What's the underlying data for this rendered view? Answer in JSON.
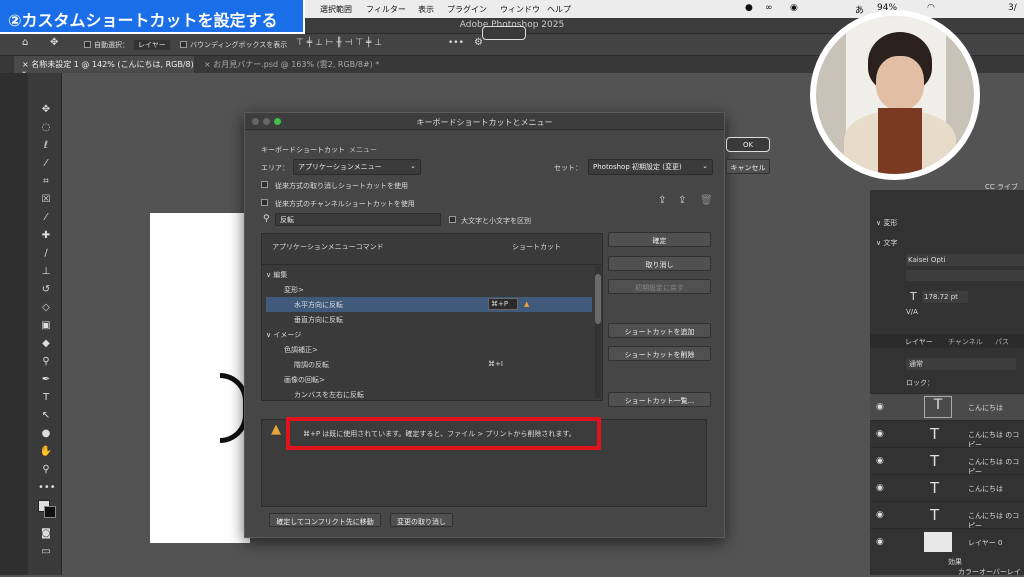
{
  "banner": "②カスタムショートカットを設定する",
  "menubar": {
    "items": [
      "選択範囲",
      "フィルター",
      "表示",
      "プラグイン",
      "ウィンドウ",
      "ヘルプ"
    ],
    "battery": "94%",
    "clock": "3/"
  },
  "app_title": "Adobe Photoshop 2025",
  "optbar": {
    "auto_select": "自動選択：",
    "auto_select_value": "レイヤー",
    "bbox": "バウンディングボックスを表示"
  },
  "tabs": [
    "名称未設定 1 @ 142% (こんにちは, RGB/8) *",
    "お月見バナー.psd @ 163% (雲2, RGB/8#) *"
  ],
  "dialog": {
    "title": "キーボードショートカットとメニュー",
    "tabs": [
      "キーボードショートカット",
      "メニュー"
    ],
    "area_label": "エリア：",
    "area_value": "アプリケーションメニュー",
    "set_label": "セット：",
    "set_value": "Photoshop 初期設定 (変更)",
    "cb1": "従来方式の取り消しショートカットを使用",
    "cb2": "従来方式のチャンネルショートカットを使用",
    "search_value": "反転",
    "case_label": "大文字と小文字を区別",
    "col_cmd": "アプリケーションメニューコマンド",
    "col_shortcut": "ショートカット",
    "rows": [
      {
        "label": "∨ 編集",
        "shortcut": ""
      },
      {
        "label": "変形>",
        "shortcut": ""
      },
      {
        "label": "水平方向に反転",
        "shortcut": "⌘+P"
      },
      {
        "label": "垂直方向に反転",
        "shortcut": ""
      },
      {
        "label": "∨ イメージ",
        "shortcut": ""
      },
      {
        "label": "色調補正>",
        "shortcut": ""
      },
      {
        "label": "階調の反転",
        "shortcut": "⌘+I"
      },
      {
        "label": "画像の回転>",
        "shortcut": ""
      },
      {
        "label": "カンバスを左右に反転",
        "shortcut": ""
      }
    ],
    "ok": "OK",
    "cancel": "キャンセル",
    "accept": "確定",
    "undo": "取り消し",
    "reset": "初期設定に戻す",
    "add_shortcut": "ショートカットを追加",
    "delete_shortcut": "ショートカットを削除",
    "summarize": "ショートカット一覧...",
    "warning": "⌘+P は既に使用されています。確定すると、ファイル > プリントから削除されます。",
    "goto_conflict": "確定してコンフリクト先に移動",
    "undo_changes": "変更の取り消し"
  },
  "panel": {
    "libs": "CC ライブ",
    "transform": "∨ 変形",
    "type": "∨ 文字",
    "font": "Kaisei Opti",
    "size": "178.72 pt",
    "va": "V/A",
    "tabs": [
      "レイヤー",
      "チャンネル",
      "パス"
    ],
    "blend": "通常",
    "lock": "ロック：",
    "layers": [
      "こんにちは",
      "こんにちは のコピー",
      "こんにちは のコピー",
      "こんにちは",
      "こんにちは のコピー",
      "レイヤー 0"
    ],
    "fx": "効果",
    "fx_item": "カラーオーバーレイ"
  },
  "colors": {
    "accent": "#1a6fe8",
    "red": "#e0121c",
    "selected_row": "#3f5a7a"
  }
}
